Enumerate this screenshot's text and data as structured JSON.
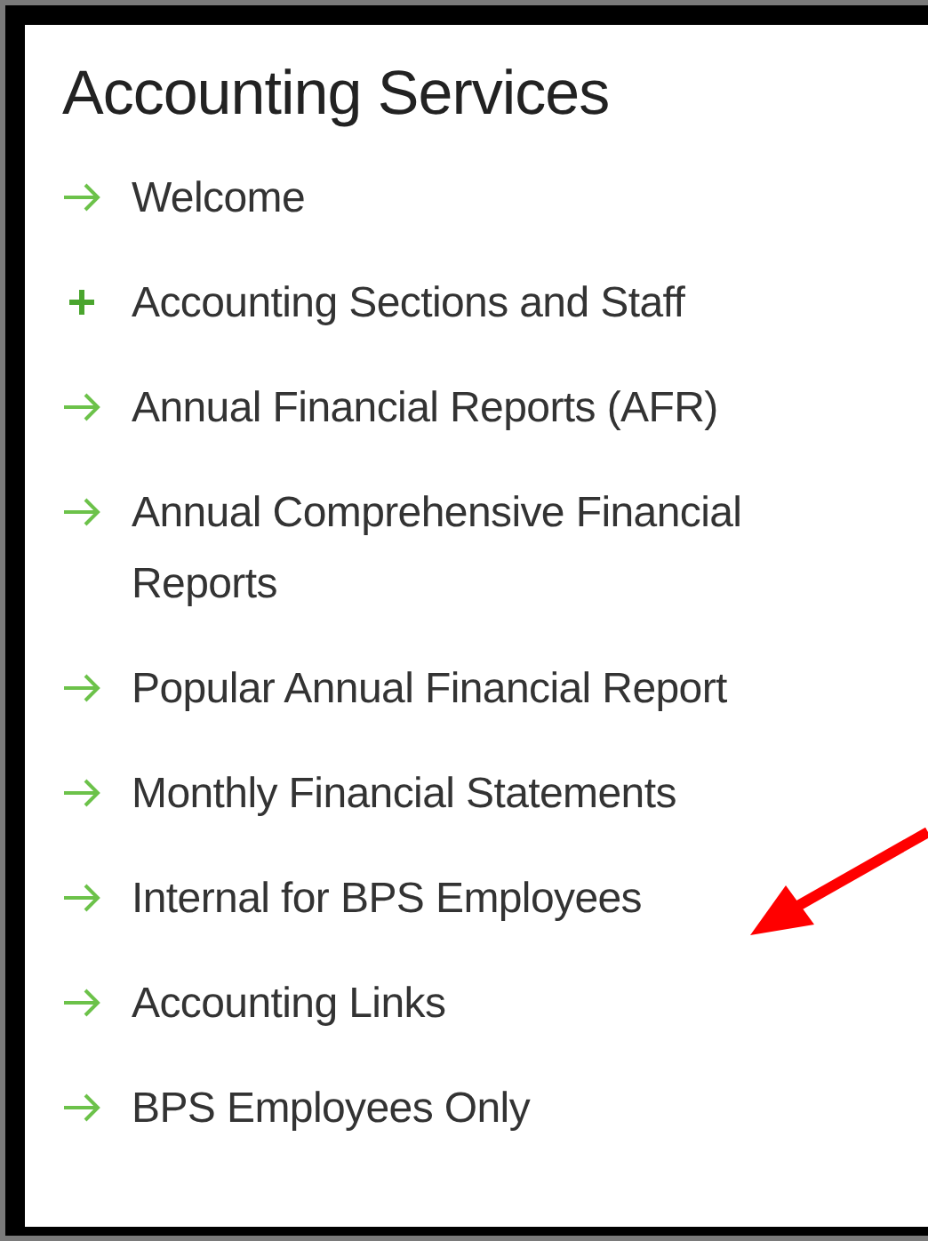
{
  "title": "Accounting Services",
  "items": [
    {
      "label": "Welcome",
      "kind": "arrow"
    },
    {
      "label": "Accounting Sections and Staff",
      "kind": "plus"
    },
    {
      "label": "Annual Financial Reports (AFR)",
      "kind": "arrow"
    },
    {
      "label": "Annual Comprehensive Financial Reports",
      "kind": "arrow"
    },
    {
      "label": "Popular Annual Financial Report",
      "kind": "arrow"
    },
    {
      "label": "Monthly Financial Statements",
      "kind": "arrow"
    },
    {
      "label": "Internal for BPS Employees",
      "kind": "arrow"
    },
    {
      "label": "Accounting Links",
      "kind": "arrow"
    },
    {
      "label": "BPS Employees Only",
      "kind": "arrow"
    }
  ]
}
